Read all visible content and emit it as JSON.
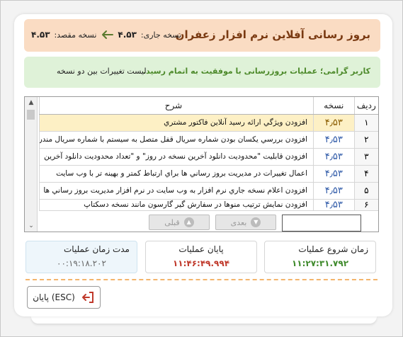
{
  "header": {
    "title": "بروز رسانی آفلاین نرم افزار زعفران",
    "current_label": "نسخه جاری:",
    "current_version": "۴.۵۳",
    "target_label": "نسخه مقصد:",
    "target_version": "۴.۵۳"
  },
  "status": {
    "message": "کاربر گرامی؛ عملیات بروزرسانی با  موفقیت به اتمام رسید.",
    "changes_link": "لیست تغییرات بین دو نسخه"
  },
  "table": {
    "columns": [
      "ردیف",
      "نسخه",
      "شرح"
    ],
    "rows": [
      {
        "n": "۱",
        "ver": "۴٫۵۳",
        "desc": "افزودن ویژگي ارائه رسید آنلاین فاکتور مشتري"
      },
      {
        "n": "۲",
        "ver": "۴٫۵۳",
        "desc": "افزودن بررسي يکسان بودن شماره سريال قفل متصل به سيستم با شماره سريال مندرج"
      },
      {
        "n": "۳",
        "ver": "۴٫۵۳",
        "desc": "افزودن قابليت \"محدوديت دانلود آخرين نسخه در روز\" و \"تعداد محدوديت دانلود آخرين"
      },
      {
        "n": "۴",
        "ver": "۴٫۵۳",
        "desc": "اعمال تغییرات در مدیریت بروز رساني ها براي ارتباط کمتر و بهينه تر با وب سایت"
      },
      {
        "n": "۵",
        "ver": "۴٫۵۳",
        "desc": "افزودن اعلام نسخه جاري نرم افزار به وب سایت در نرم افزار مدیریت بروز رساني ها"
      },
      {
        "n": "۶",
        "ver": "۴٫۵۳",
        "desc": "افزودن نمایش ترتیب منوها در سفارش گیر گارسون مانند نسخه دسکتاپ"
      }
    ]
  },
  "pager": {
    "next_label": "بعدی",
    "prev_label": "قبلی",
    "page_value": ""
  },
  "stats": {
    "start_label": "زمان شروع عملیات",
    "start_value": "۱۱:۲۷:۳۱.۷۹۲",
    "end_label": "پایان عملیات",
    "end_value": "۱۱:۴۶:۴۹.۹۹۴",
    "duration_label": "مدت زمان عملیات",
    "duration_value": "۰۰:۱۹:۱۸.۲۰۲"
  },
  "exit": {
    "label": "پایان (ESC)"
  },
  "colors": {
    "header_bg": "#fadcc3",
    "title": "#7a3a12",
    "status_bg": "#dff2d8",
    "status_text": "#4d8a2b",
    "start_time": "#3f8a2c",
    "end_time": "#c0392b",
    "exit_icon": "#c0392b"
  },
  "icons": {
    "version_arrow": "arrow-left-icon",
    "exit": "exit-door-icon",
    "next": "chevron-down-circle-icon",
    "prev": "chevron-up-circle-icon"
  }
}
